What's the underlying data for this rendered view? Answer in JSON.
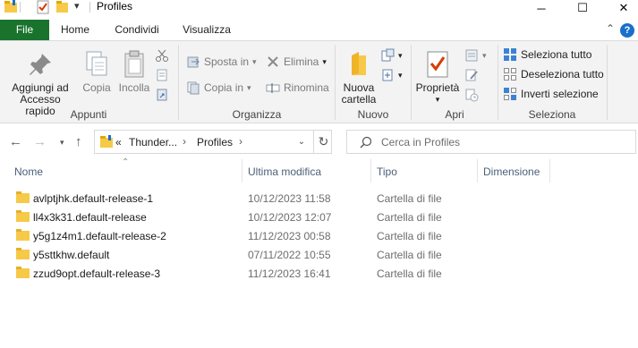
{
  "window": {
    "title": "Profiles",
    "minimize_glyph": "─",
    "maximize_glyph": "☐",
    "close_glyph": "✕"
  },
  "ribbon_tabs": [
    "File",
    "Home",
    "Condividi",
    "Visualizza"
  ],
  "ribbon": {
    "appunti": {
      "label": "Appunti",
      "pin_line1": "Aggiungi ad",
      "pin_line2": "Accesso rapido",
      "copy": "Copia",
      "paste": "Incolla"
    },
    "organizza": {
      "label": "Organizza",
      "move_to": "Sposta in",
      "copy_to": "Copia in",
      "delete": "Elimina",
      "rename": "Rinomina"
    },
    "nuovo": {
      "label": "Nuovo",
      "new_folder_line1": "Nuova",
      "new_folder_line2": "cartella"
    },
    "apri": {
      "label": "Apri",
      "properties": "Proprietà"
    },
    "seleziona": {
      "label": "Seleziona",
      "select_all": "Seleziona tutto",
      "select_none": "Deseleziona tutto",
      "invert": "Inverti selezione"
    }
  },
  "navigation": {
    "breadcrumb_prefix": "«",
    "breadcrumbs": [
      "Thunder...",
      "Profiles"
    ],
    "search_placeholder": "Cerca in Profiles"
  },
  "columns": {
    "name": "Nome",
    "modified": "Ultima modifica",
    "type": "Tipo",
    "size": "Dimensione"
  },
  "files": [
    {
      "name": "avlptjhk.default-release-1",
      "modified": "10/12/2023 11:58",
      "type": "Cartella di file"
    },
    {
      "name": "ll4x3k31.default-release",
      "modified": "10/12/2023 12:07",
      "type": "Cartella di file"
    },
    {
      "name": "y5g1z4m1.default-release-2",
      "modified": "11/12/2023 00:58",
      "type": "Cartella di file"
    },
    {
      "name": "y5sttkhw.default",
      "modified": "07/11/2022 10:55",
      "type": "Cartella di file"
    },
    {
      "name": "zzud9opt.default-release-3",
      "modified": "11/12/2023 16:41",
      "type": "Cartella di file"
    }
  ],
  "colors": {
    "file_tab": "#19732d",
    "folder": "#f7c948",
    "accent_blue": "#1a6fc9"
  }
}
